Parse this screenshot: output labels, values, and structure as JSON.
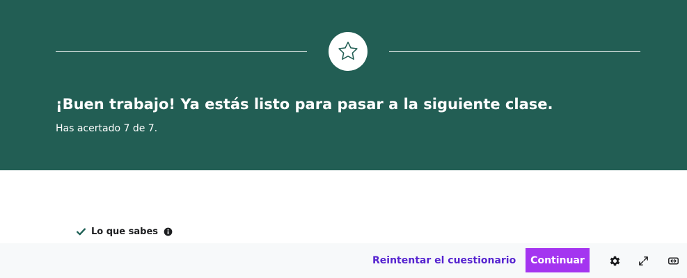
{
  "result": {
    "title": "¡Buen trabajo! Ya estás listo para pasar a la siguiente clase.",
    "score_text": "Has acertado 7 de 7.",
    "correct": 7,
    "total": 7
  },
  "knowledge": {
    "label": "Lo que sabes"
  },
  "footer": {
    "retake_label": "Reintentar el cuestionario",
    "continue_label": "Continuar"
  },
  "icons": {
    "badge": "star-icon",
    "knowledge": "check-icon",
    "info": "info-icon",
    "settings": "gear-icon",
    "fullscreen": "expand-icon",
    "theater": "theater-mode-icon"
  },
  "colors": {
    "hero_bg": "#225e54",
    "accent_purple": "#a435f0",
    "link_purple": "#5624d0",
    "check_green": "#1e6055",
    "footer_bg": "#f7f9fa"
  }
}
